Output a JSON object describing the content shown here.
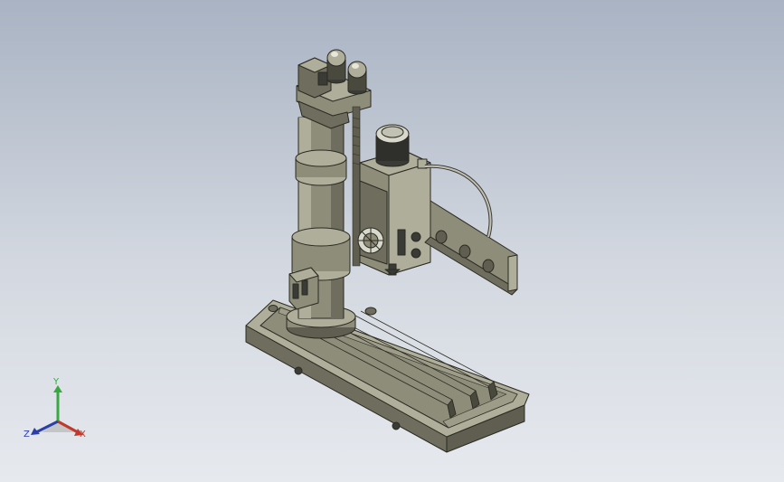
{
  "window": {
    "title": ""
  },
  "model": {
    "description_icon": "radial-drill-press-model",
    "colors": {
      "body": "#8e8d7a",
      "body_light": "#aeae9a",
      "body_dark": "#5f5e50",
      "edge": "#2b2a22",
      "motor": "#3a3a36",
      "background_top": "#a9b3c3",
      "background_bottom": "#e6e9ee"
    }
  },
  "triad": {
    "x_label": "X",
    "y_label": "Y",
    "z_label": "Z",
    "colors": {
      "x": "#c0392b",
      "y": "#3aa842",
      "z": "#2c3ea8"
    }
  }
}
